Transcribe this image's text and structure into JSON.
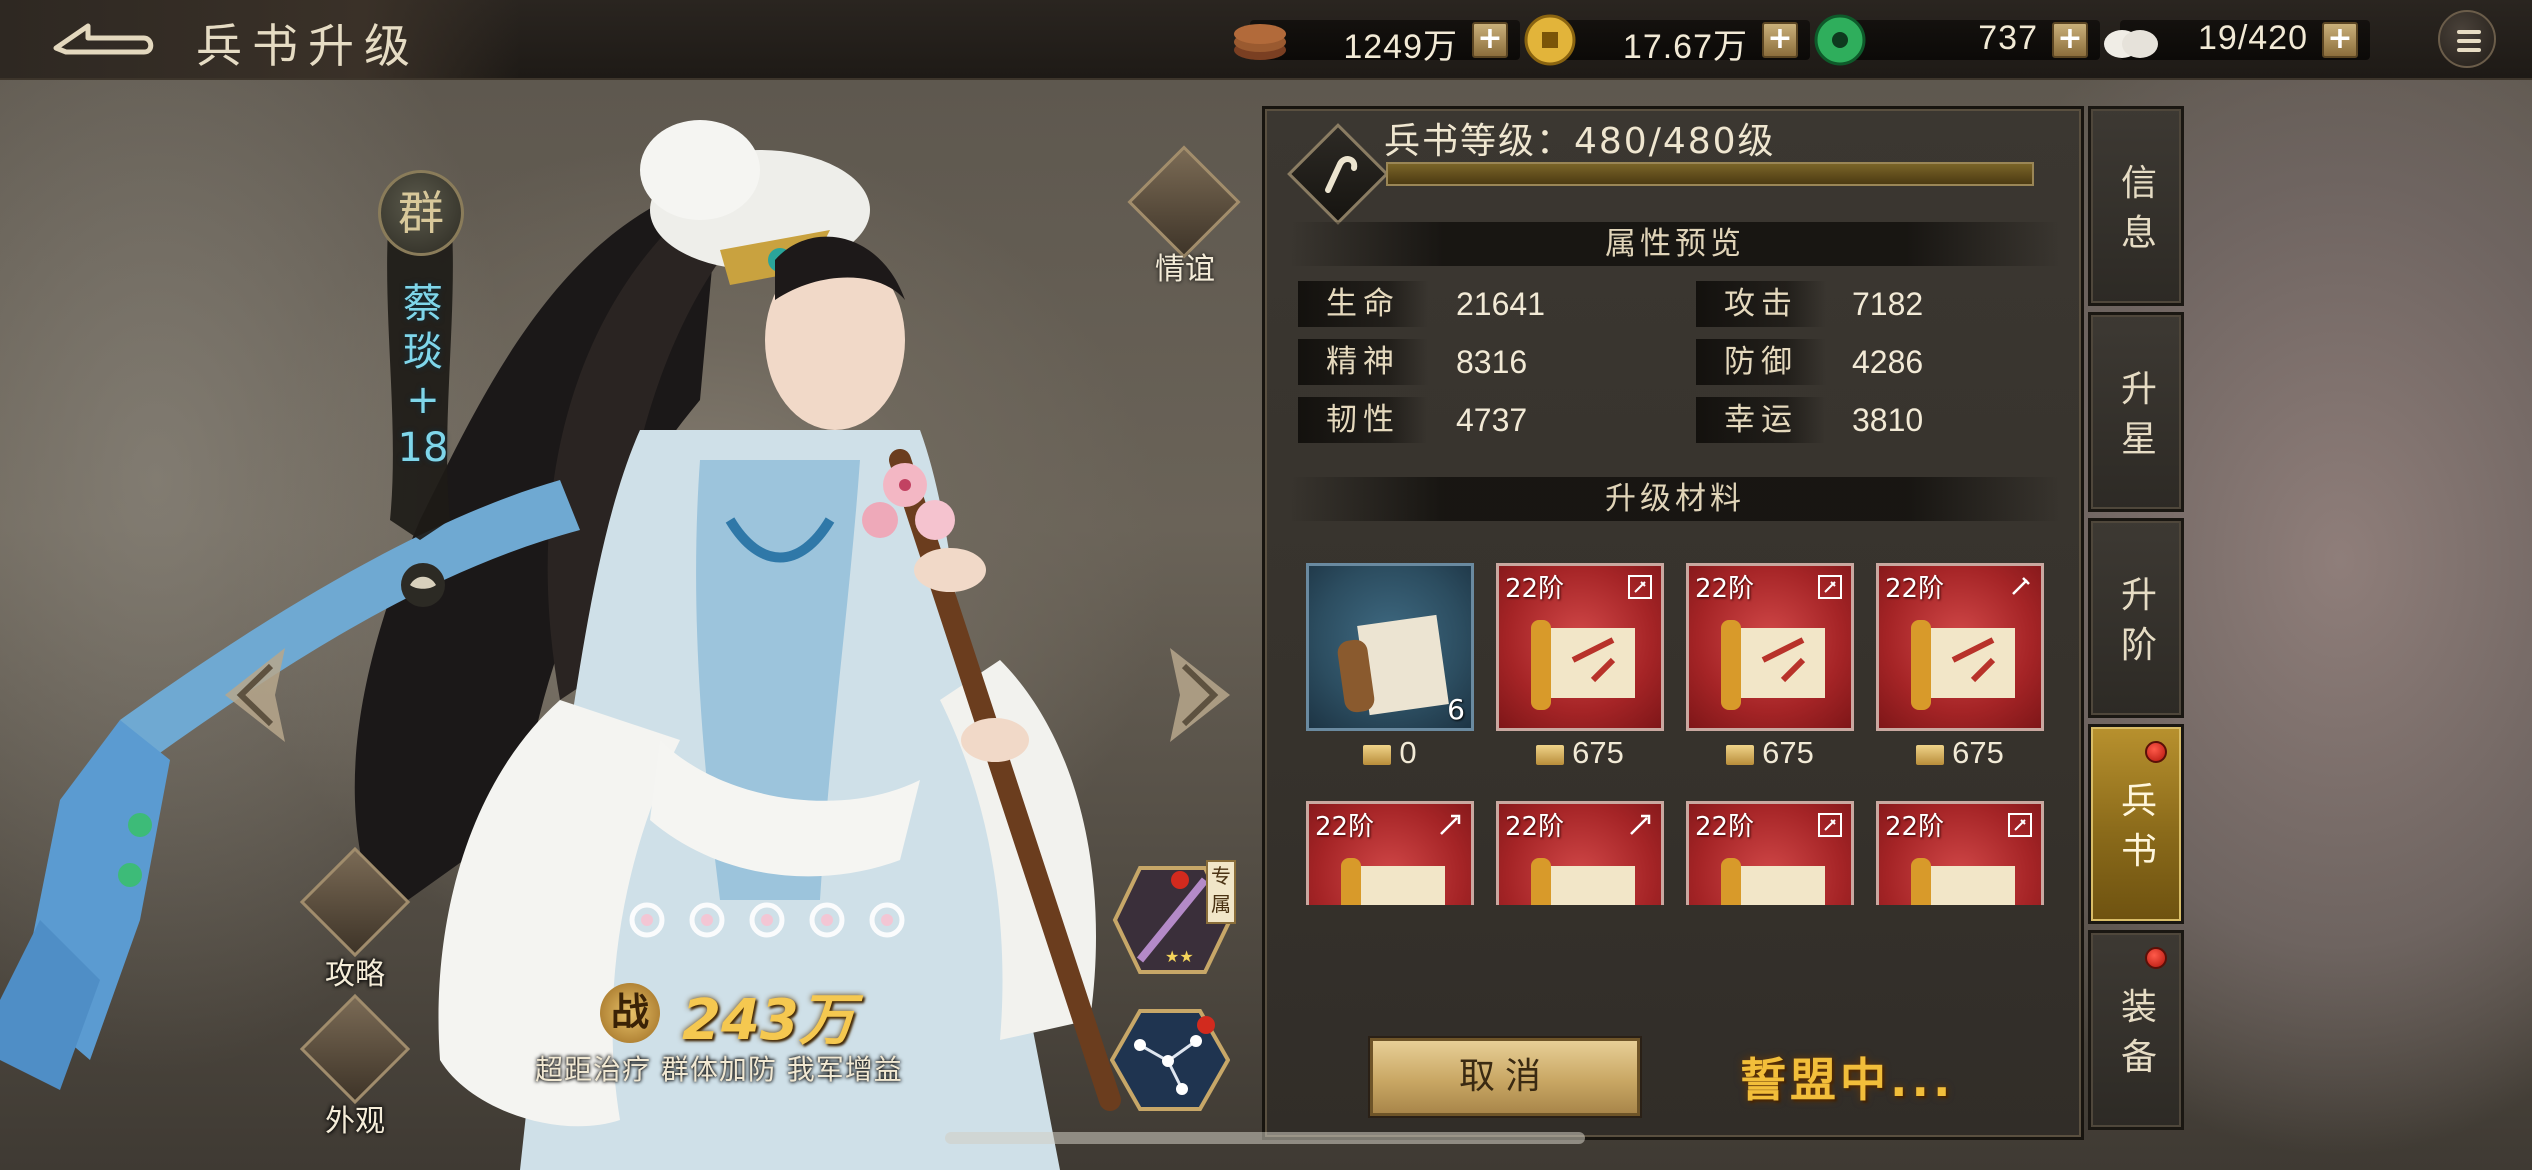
{
  "header": {
    "title": "兵书升级",
    "resources": [
      {
        "icon": "copper-coins-icon",
        "value": "1249万"
      },
      {
        "icon": "gold-coin-icon",
        "value": "17.67万"
      },
      {
        "icon": "jade-icon",
        "value": "737"
      },
      {
        "icon": "bun-stamina-icon",
        "value": "19/420"
      }
    ],
    "plus_label": "+"
  },
  "hero": {
    "faction": "群",
    "name_chars": [
      "蔡",
      "琰",
      "+",
      "18"
    ],
    "power_mark": "战",
    "power": "243万",
    "skills": "超距治疗 群体加防 我军增益",
    "exclusive_label": "专属"
  },
  "left_buttons": {
    "friendship": "情谊",
    "strategy": "攻略",
    "appearance": "外观"
  },
  "panel": {
    "level_title": "兵书等级：480/480级",
    "level_fill": 1.0,
    "attr_header": "属性预览",
    "attributes": [
      {
        "label": "生命",
        "value": "21641"
      },
      {
        "label": "攻击",
        "value": "7182"
      },
      {
        "label": "精神",
        "value": "8316"
      },
      {
        "label": "防御",
        "value": "4286"
      },
      {
        "label": "韧性",
        "value": "4737"
      },
      {
        "label": "幸运",
        "value": "3810"
      }
    ],
    "mat_header": "升级材料",
    "materials": [
      {
        "kind": "scroll-book",
        "tier": "",
        "count": "6",
        "cost": "0"
      },
      {
        "kind": "axe-scroll",
        "tier": "22阶",
        "count": "",
        "cost": "675"
      },
      {
        "kind": "axe-scroll",
        "tier": "22阶",
        "count": "",
        "cost": "675"
      },
      {
        "kind": "halberd-scroll",
        "tier": "22阶",
        "count": "",
        "cost": "675"
      },
      {
        "kind": "spear-scroll",
        "tier": "22阶",
        "count": "",
        "cost": ""
      },
      {
        "kind": "spear-scroll",
        "tier": "22阶",
        "count": "",
        "cost": ""
      },
      {
        "kind": "axe-scroll",
        "tier": "22阶",
        "count": "",
        "cost": ""
      },
      {
        "kind": "axe-scroll",
        "tier": "22阶",
        "count": "",
        "cost": ""
      }
    ],
    "cancel_label": "取消",
    "status_text": "誓盟中..."
  },
  "tabs": [
    {
      "label": "信息",
      "active": false,
      "dot": false
    },
    {
      "label": "升星",
      "active": false,
      "dot": false
    },
    {
      "label": "升阶",
      "active": false,
      "dot": false
    },
    {
      "label": "兵书",
      "active": true,
      "dot": true
    },
    {
      "label": "装备",
      "active": false,
      "dot": true
    }
  ],
  "colors": {
    "accent_gold": "#f2be3a",
    "hero_name_cyan": "#7fd6ea",
    "active_tab": "#b8912e",
    "material_red": "#a52426"
  }
}
